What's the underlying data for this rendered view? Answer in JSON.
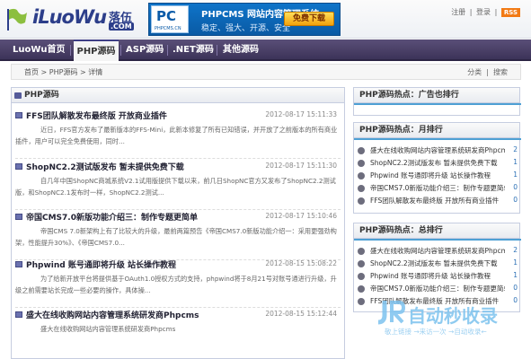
{
  "header": {
    "logo_text": "iLuoWu",
    "logo_cn": "落伍",
    "logo_com": ".COM",
    "banner_logo": "PC",
    "banner_logo_sub": "PHPCMS.CN",
    "banner_title": "PHPCMS 网站内容管理系统",
    "banner_slogan": "稳定、强大、开源、安全",
    "banner_button": "免费下载",
    "links": {
      "register": "注册",
      "sep1": "|",
      "login": "登录",
      "sep2": "|",
      "rss": "RSS"
    }
  },
  "nav": {
    "items": [
      {
        "label": "LuoWu首页"
      },
      {
        "label": "PHP源码"
      },
      {
        "label": "ASP源码"
      },
      {
        "label": ".NET源码"
      },
      {
        "label": "其他源码"
      }
    ]
  },
  "breadcrumb": {
    "path": "首页 > PHP源码 > 详情",
    "category": "分类",
    "search": "搜索"
  },
  "main": {
    "title": "PHP源码",
    "posts": [
      {
        "title": "FFS团队解散发布最终版 开放商业插件",
        "date": "2012-08-17 15:11:33",
        "desc": "近日，FFS官方发布了最新版本的FFS-Mini，此新本修复了所有已知错误，并开放了之前版本的所有商业插件，用户可以完全免费使用，同时..."
      },
      {
        "title": "ShopNC2.2测试版发布 暂未提供免费下载",
        "date": "2012-08-17 15:11:30",
        "desc": "自几年中国ShopNC商城系统V2.1试用版提供下载以来，前几日ShopNC官方又发布了ShopNC2.2测试版，和ShopNC2.1发布时一样，ShopNC2.2测试..."
      },
      {
        "title": "帝国CMS7.0新版功能介绍三：制作专题更简单",
        "date": "2012-08-17 15:10:46",
        "desc": "帝国CMS 7.0新架构上有了比较大的升级，最前两篇预告《帝国CMS7.0新版功能介绍一：采用更强劲构架，性能提升30%》、《帝国CMS7.0..."
      },
      {
        "title": "Phpwind 账号通即将升级 站长操作教程",
        "date": "2012-08-15 15:08:22",
        "desc": "为了给新开放平台将提供基于OAuth1.0授权方式的支持，phpwind将于8月21号对账号通进行升级，升级之前需要站长完成一些必要的操作，具体操..."
      },
      {
        "title": "盛大在线收购网站内容管理系统研发商Phpcms",
        "date": "2012-08-15 15:12:44",
        "desc": "盛大在线收购网站内容管理系统研发商Phpcms"
      }
    ]
  },
  "sidebar": {
    "ad_title": "PHP源码热点：广告也排行",
    "month_title": "PHP源码热点：月排行",
    "month_items": [
      {
        "title": "盛大在线收购网站内容管理系统研发商Phpcms",
        "count": "2"
      },
      {
        "title": "ShopNC2.2测试版发布 暂未提供免费下载",
        "count": "1"
      },
      {
        "title": "Phpwind 账号通即将升级 站长操作教程",
        "count": "1"
      },
      {
        "title": "帝国CMS7.0新版功能介绍三：制作专题更简单",
        "count": "0"
      },
      {
        "title": "FFS团队解散发布最终版 开放所有商业插件",
        "count": "0"
      }
    ],
    "total_title": "PHP源码热点：总排行",
    "total_items": [
      {
        "title": "盛大在线收购网站内容管理系统研发商Phpcms",
        "count": "2"
      },
      {
        "title": "ShopNC2.2测试版发布 暂未提供免费下载",
        "count": "1"
      },
      {
        "title": "Phpwind 账号通即将升级 站长操作教程",
        "count": "1"
      },
      {
        "title": "帝国CMS7.0新版功能介绍三：制作专题更简单",
        "count": "0"
      },
      {
        "title": "FFS团队解散发布最终版 开放所有商业插件",
        "count": "0"
      }
    ]
  },
  "watermark": {
    "brand": "自动秒收录",
    "slogan": "敬上链接 →来访一次 →自动收录←"
  }
}
